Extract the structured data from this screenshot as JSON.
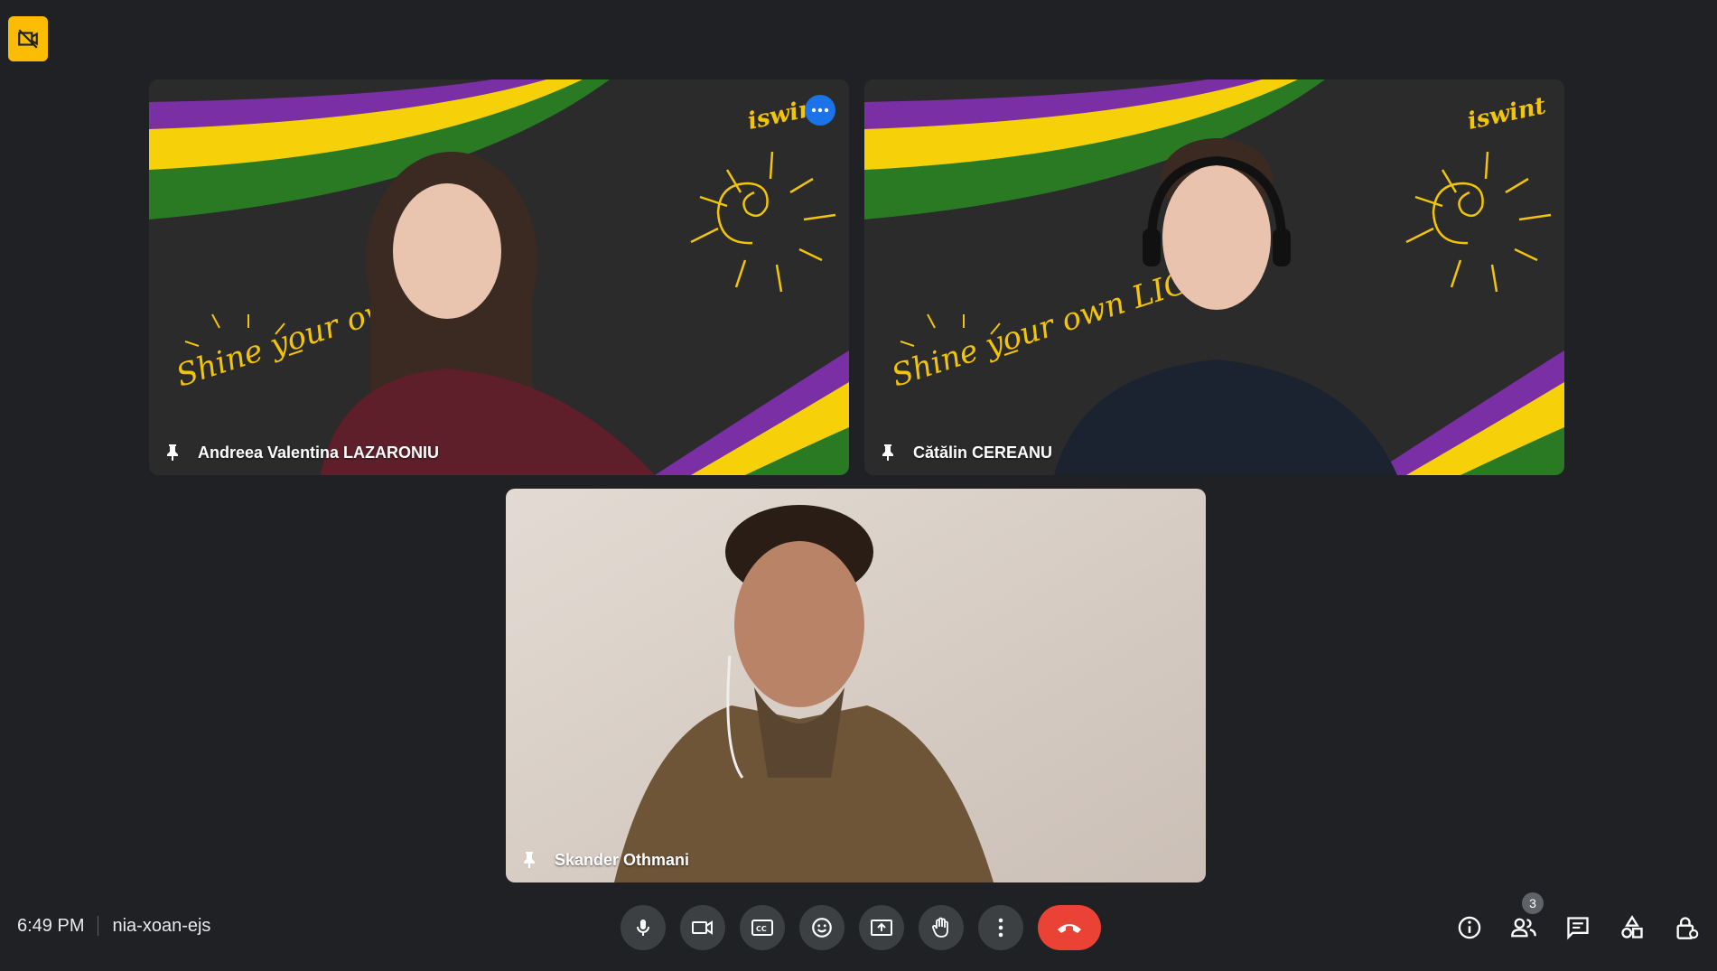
{
  "participants": [
    {
      "name": "Andreea Valentina LAZARONIU",
      "overlay": "Shine your own LIGHT",
      "brand": "iswint"
    },
    {
      "name": "Cătălin CEREANU",
      "overlay": "Shine your own LIGHT",
      "brand": "iswint"
    },
    {
      "name": "Skander Othmani"
    }
  ],
  "footer": {
    "time": "6:49 PM",
    "meeting_code": "nia-xoan-ejs"
  },
  "people_count": "3",
  "icons": {
    "top_badge": "video-off-icon",
    "pin": "pin-icon",
    "more": "more-options-icon",
    "controls": [
      "microphone-icon",
      "camera-icon",
      "captions-icon",
      "emoji-icon",
      "present-icon",
      "raise-hand-icon",
      "more-vert-icon",
      "hang-up-icon"
    ],
    "right": [
      "info-icon",
      "people-icon",
      "chat-icon",
      "activities-icon",
      "host-controls-icon"
    ]
  },
  "colors": {
    "background": "#202124",
    "control": "#3c4043",
    "hangup": "#ea4335",
    "badge": "#fbbc04",
    "accent": "#1a73e8",
    "stripe_purple": "#7a2fa4",
    "stripe_yellow": "#f6d10a",
    "stripe_green": "#2a7a24"
  }
}
